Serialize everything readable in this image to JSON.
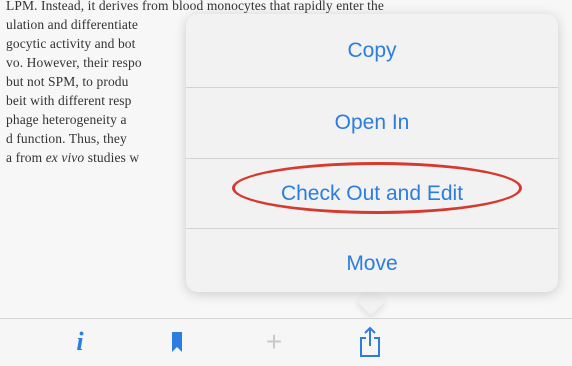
{
  "document": {
    "lines": [
      "LPM. Instead, it derives from blood monocytes that rapidly enter the",
      "ulation and differentiate",
      "gocytic activity and bot",
      "vo. However, their respo",
      " but not SPM, to produ",
      "beit with different resp",
      "phage heterogeneity a",
      "d function. Thus, they",
      "a from ",
      "ex vivo",
      " studies w"
    ]
  },
  "menu": {
    "copy": "Copy",
    "open_in": "Open In",
    "check_out_edit": "Check Out and Edit",
    "move": "Move"
  },
  "toolbar": {
    "info_icon": "info-icon",
    "bookmark_icon": "bookmark-icon",
    "add_icon": "plus-icon",
    "share_icon": "share-icon"
  },
  "colors": {
    "accent": "#2b7de0",
    "highlight": "#d63a2f",
    "disabled": "#c9c9c9"
  }
}
